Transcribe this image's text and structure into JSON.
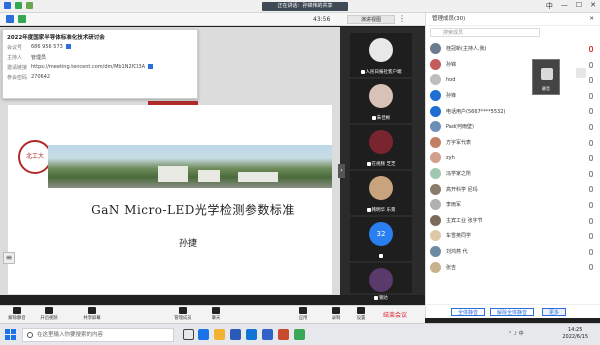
{
  "top_bar": {
    "meeting_chip": "正在讲话：孙锦伟的共享"
  },
  "sub_bar": {
    "timer": "43:56",
    "layout_button": "演讲视图"
  },
  "info_popup": {
    "title": "2022年度国家半导体标准化技术研讨会",
    "rows": [
      {
        "key": "会议号",
        "value": "686 956 573"
      },
      {
        "key": "主持人",
        "value": "管理员"
      },
      {
        "key": "邀请链接",
        "value": "https://meeting.tencent.com/dm/Mb1N2fCI3A"
      },
      {
        "key": "参会密码",
        "value": "270642"
      }
    ]
  },
  "slide": {
    "title": "GaN Micro-LED光学检测参数标准",
    "author": "孙捷",
    "logo_text": "北工大"
  },
  "video_tiles": [
    {
      "name": "人民日报社客户端",
      "color": "#e8e8e8"
    },
    {
      "name": "朱佳彬",
      "color": "#d8c2b8"
    },
    {
      "name": "在视频 芝芝",
      "color": "#7a2430"
    },
    {
      "name": "韩明华 乐景",
      "color": "#c9a37e"
    },
    {
      "name": "32",
      "color": "#2a7ff0"
    },
    {
      "name": "钢达",
      "color": "#5a3a6a"
    }
  ],
  "participants": {
    "header": "管理成员(30)",
    "search_placeholder": "搜索成员",
    "float_cam_caption": "静音",
    "list": [
      {
        "name": "桂冠新(主持人,我)",
        "color": "#6b7c8f"
      },
      {
        "name": "孙锦",
        "color": "#c25b5b"
      },
      {
        "name": "hod",
        "color": "#bdbdbd"
      },
      {
        "name": "孙锋",
        "color": "#1f6fd1"
      },
      {
        "name": "电话用户(5667****5532)",
        "color": "#1f6fd1"
      },
      {
        "name": "Pad(何雨壁)",
        "color": "#6c8fb8"
      },
      {
        "name": "方字军代表",
        "color": "#c18062"
      },
      {
        "name": "zyh",
        "color": "#d1a08c"
      },
      {
        "name": "冯学家之所",
        "color": "#a0c8b0"
      },
      {
        "name": "高开科学 尼玛",
        "color": "#8a7c6a"
      },
      {
        "name": "李雨军",
        "color": "#b0b0b0"
      },
      {
        "name": "主宾工业 张字节",
        "color": "#7a6b5c"
      },
      {
        "name": "车雪英同学",
        "color": "#e0c7a8"
      },
      {
        "name": "刘鸿燕 代",
        "color": "#6e8aa3"
      },
      {
        "name": "张吉",
        "color": "#c9b18d"
      }
    ],
    "footer_buttons": [
      "全体静音",
      "解除全体静音",
      "更多"
    ]
  },
  "toolbar": {
    "items": [
      "解除静音",
      "开启视频",
      "共享屏幕",
      "管理成员",
      "聊天",
      "应用",
      "录制",
      "设置"
    ],
    "end_label": "结束会议"
  },
  "taskbar": {
    "search_text": "在这里输入你要搜索的内容",
    "time": "14:25",
    "date": "2022/6/15",
    "lang": "中"
  },
  "colors": {
    "accent": "#2a6fdb",
    "end_red": "#d9222a",
    "slide_red": "#b12b2b"
  }
}
